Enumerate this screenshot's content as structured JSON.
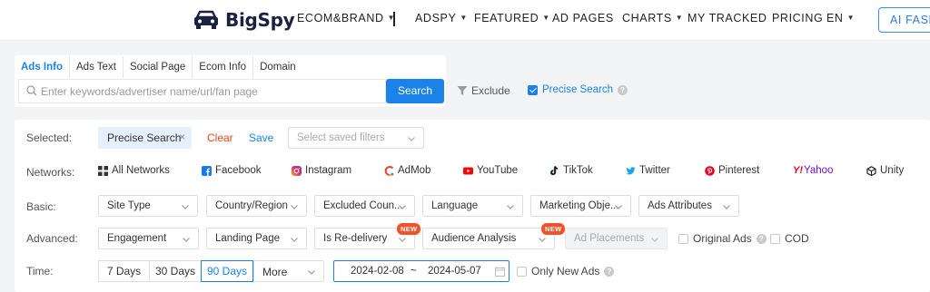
{
  "header": {
    "brand": "BigSpy",
    "nav": [
      {
        "label": "ECOM&BRAND",
        "caret": true
      },
      {
        "label": "ADSPY",
        "caret": true
      },
      {
        "label": "FEATURED",
        "caret": true
      },
      {
        "label": "AD PAGES",
        "caret": false
      },
      {
        "label": "CHARTS",
        "caret": true
      },
      {
        "label": "MY TRACKED",
        "caret": false
      },
      {
        "label": "PRICING",
        "caret": false
      },
      {
        "label": "EN",
        "caret": true
      }
    ],
    "ai_button": "AI FASH"
  },
  "search": {
    "tabs": [
      "Ads Info",
      "Ads Text",
      "Social Page",
      "Ecom Info",
      "Domain"
    ],
    "active_tab": "Ads Info",
    "placeholder": "Enter keywords/advertiser name/url/fan page",
    "value": "",
    "button": "Search",
    "exclude": "Exclude",
    "precise_search": {
      "label": "Precise Search",
      "checked": true
    }
  },
  "filters": {
    "selected": {
      "label": "Selected:",
      "chip": "Precise Search",
      "clear": "Clear",
      "save": "Save",
      "saved_filters_placeholder": "Select saved filters"
    },
    "networks": {
      "label": "Networks:",
      "items": [
        "All Networks",
        "Facebook",
        "Instagram",
        "AdMob",
        "YouTube",
        "TikTok",
        "Twitter",
        "Pinterest",
        "Yahoo",
        "Unity"
      ]
    },
    "basic": {
      "label": "Basic:",
      "items": [
        "Site Type",
        "Country/Region",
        "Excluded Coun...",
        "Language",
        "Marketing Obje...",
        "Ads Attributes"
      ]
    },
    "advanced": {
      "label": "Advanced:",
      "items": [
        "Engagement",
        "Landing Page",
        "Is Re-delivery",
        "Audience Analysis",
        "Ad Placements"
      ],
      "new_badge": "NEW",
      "original_ads": "Original Ads",
      "cod": "COD"
    },
    "time": {
      "label": "Time:",
      "buttons": [
        "7 Days",
        "30 Days",
        "90 Days"
      ],
      "active": "90 Days",
      "more": "More",
      "start_date": "2024-02-08",
      "separator": "~",
      "end_date": "2024-05-07",
      "only_new_ads": "Only New Ads"
    }
  },
  "colors": {
    "accent": "#1a82e8",
    "clear": "#e04b1a",
    "new_badge": "#f0532a",
    "chip_bg": "#e6effc"
  }
}
